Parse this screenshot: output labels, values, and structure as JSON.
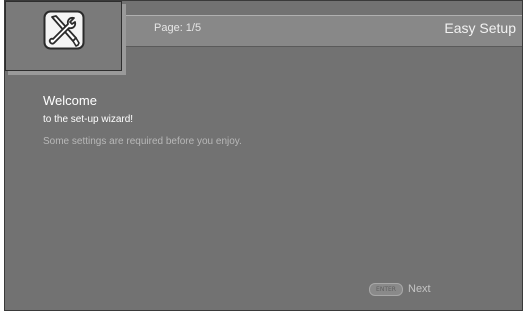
{
  "header": {
    "page_indicator": "Page: 1/5",
    "title": "Easy Setup",
    "icon": "tools-icon"
  },
  "welcome": {
    "title": "Welcome",
    "subtitle": "to the set-up wizard!",
    "body": "Some settings are required before you enjoy."
  },
  "navigation": {
    "enter_key_label": "ENTER",
    "next_label": "Next"
  },
  "colors": {
    "background": "#727272",
    "header_bar": "#888888",
    "text_primary": "#ffffff",
    "text_muted": "#b8b8b8"
  }
}
